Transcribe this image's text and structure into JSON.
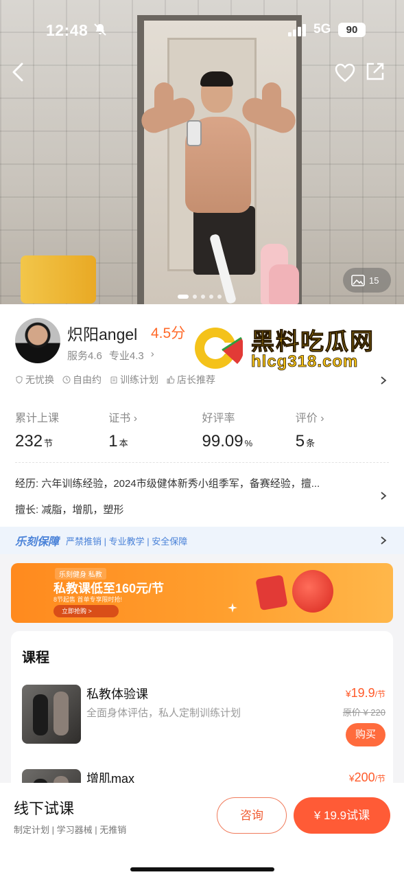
{
  "status": {
    "time": "12:48",
    "network": "5G",
    "battery": "90"
  },
  "hero": {
    "photo_count": "15"
  },
  "coach": {
    "name": "炽阳angel",
    "rating": "4.5分",
    "service_score": "服务4.6",
    "pro_score": "专业4.3",
    "tags": [
      "无忧换",
      "自由约",
      "训练计划",
      "店长推荐"
    ]
  },
  "stats": [
    {
      "label": "累计上课",
      "value": "232",
      "unit": "节"
    },
    {
      "label": "证书",
      "value": "1",
      "unit": "本"
    },
    {
      "label": "好评率",
      "value": "99.09",
      "unit": "%"
    },
    {
      "label": "评价",
      "value": "5",
      "unit": "条"
    }
  ],
  "experience": "经历: 六年训练经验，2024市级健体新秀小组季军，备赛经验，擅...",
  "skills": "擅长: 减脂，增肌，塑形",
  "guarantee": {
    "brand": "乐刻保障",
    "text": "严禁推销 | 专业教学 | 安全保障"
  },
  "banner": {
    "brand": "乐刻健身 私教",
    "title": "私教课低至160元/节",
    "subtitle": "8节起售 首单专享限时抢!",
    "button": "立即抢购 >"
  },
  "courses": {
    "title": "课程",
    "items": [
      {
        "name": "私教体验课",
        "desc": "全面身体评估，私人定制训练计划",
        "price_symbol": "¥",
        "price": "19.9",
        "per": "/节",
        "original": "原价 ¥ 220",
        "buy": "购买"
      },
      {
        "name": "增肌max",
        "desc": "",
        "price_symbol": "¥",
        "price": "200",
        "per": "/节",
        "original": "",
        "buy": ""
      }
    ]
  },
  "bottom_bar": {
    "title": "线下试课",
    "subtitle": "制定计划 | 学习器械 | 无推销",
    "consult": "咨询",
    "trial": "¥ 19.9试课"
  },
  "watermark": {
    "title": "黑料吃瓜网",
    "url": "hlcg318.com"
  },
  "colors": {
    "accent": "#ff5b36",
    "rating": "#ff6a2a",
    "guarantee": "#4a82d8",
    "watermark": "#f4c21a"
  }
}
